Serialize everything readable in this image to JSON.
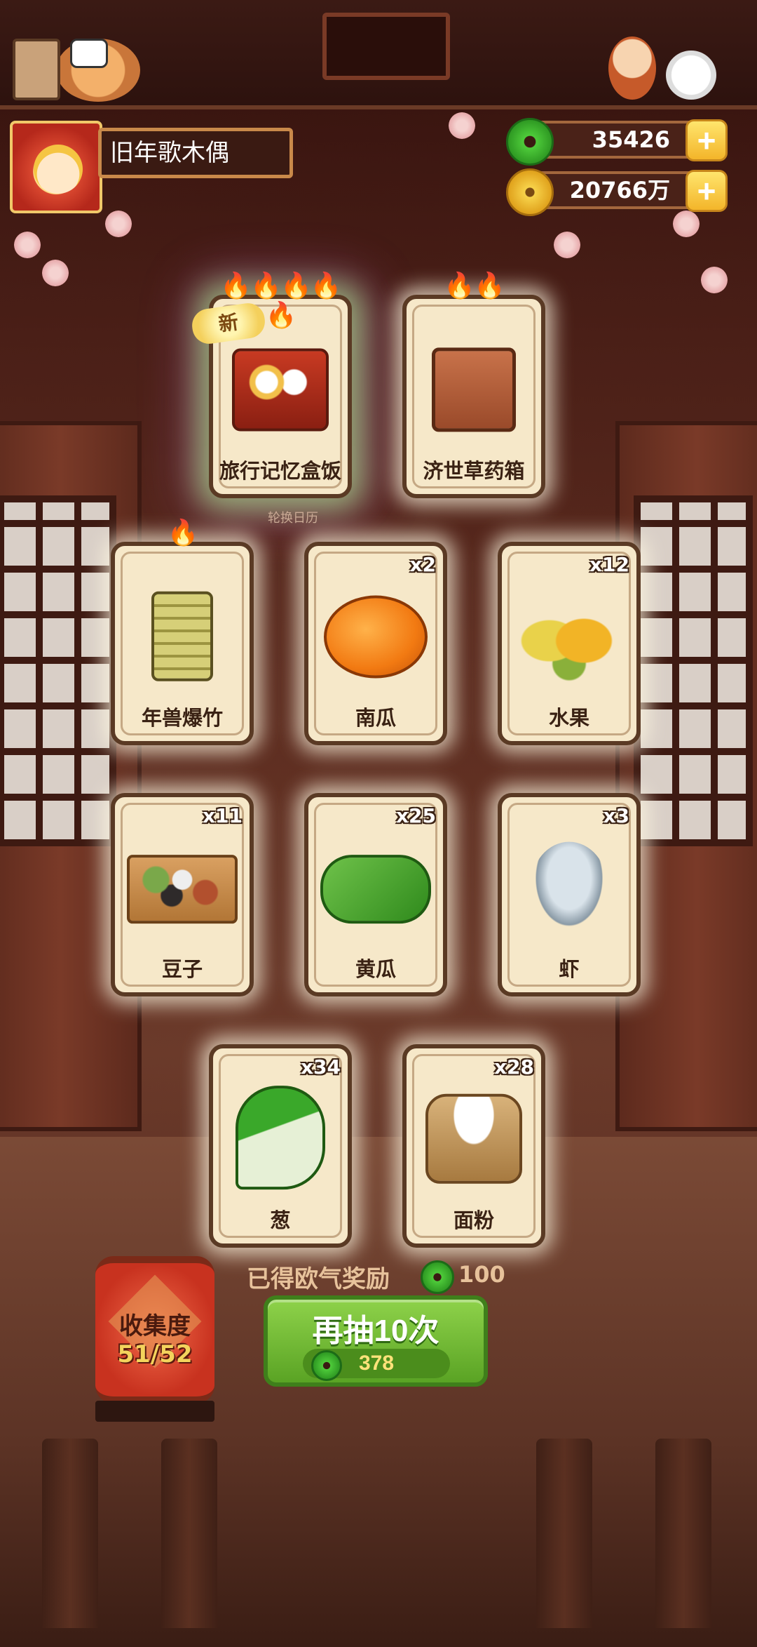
{
  "player": {
    "name": "旧年歌木偶",
    "avatar_icon": "player-avatar"
  },
  "currency": {
    "jade": {
      "value": "35426",
      "icon": "jade-icon"
    },
    "coins": {
      "value": "20766万",
      "icon": "coin-icon"
    },
    "plus_label": "+"
  },
  "cards_top": [
    {
      "label": "旅行记忆盒饭",
      "flames": "🔥🔥🔥🔥🔥",
      "badge": "新",
      "icon": "bento-icon"
    },
    {
      "label": "济世草药箱",
      "flames": "🔥🔥",
      "icon": "herb-box-icon"
    }
  ],
  "small_caption": "轮换日历",
  "cards_grid": [
    {
      "label": "年兽爆竹",
      "flames": "🔥",
      "count": "",
      "icon": "firecracker-icon"
    },
    {
      "label": "南瓜",
      "count": "x2",
      "icon": "pumpkin-icon"
    },
    {
      "label": "水果",
      "count": "x12",
      "icon": "fruit-icon"
    },
    {
      "label": "豆子",
      "count": "x11",
      "icon": "beans-icon"
    },
    {
      "label": "黄瓜",
      "count": "x25",
      "icon": "cucumber-icon"
    },
    {
      "label": "虾",
      "count": "x3",
      "icon": "shrimp-icon"
    },
    {
      "label": "葱",
      "count": "x34",
      "icon": "scallion-icon"
    },
    {
      "label": "面粉",
      "count": "x28",
      "icon": "flour-icon"
    }
  ],
  "reward": {
    "label": "已得欧气奖励",
    "value": "100"
  },
  "draw_button": {
    "label": "再抽10次",
    "cost": "378"
  },
  "collection": {
    "label": "收集度",
    "value": "51/52"
  },
  "colors": {
    "accent_green": "#5aa324",
    "card_bg": "#f6e8c9",
    "gold": "#f3b52a"
  }
}
